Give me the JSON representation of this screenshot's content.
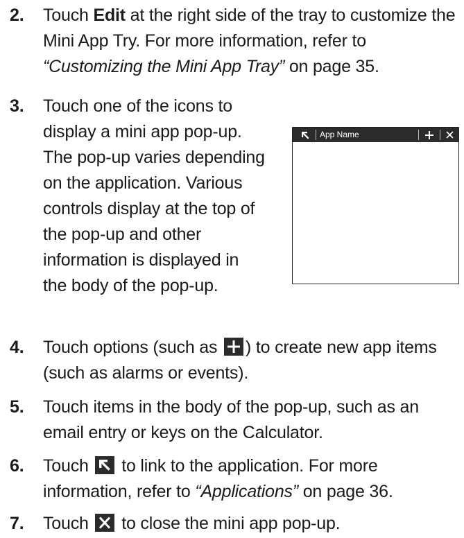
{
  "steps": [
    {
      "number": "2.",
      "lines": [
        [
          "Touch ",
          {
            "b": "Edit"
          },
          " at the right side of the tray to customize the"
        ],
        [
          "Mini App Try. For more information, refer to"
        ],
        [
          {
            "i": "“Customizing the Mini App Tray”"
          },
          " on page 35."
        ]
      ]
    },
    {
      "number": "3.",
      "lines": [
        [
          "Touch one of the icons to"
        ],
        [
          "display a mini app pop-up."
        ],
        [
          "The pop-up varies depending"
        ],
        [
          "on the application. Various"
        ],
        [
          "controls display at the top of"
        ],
        [
          "the pop-up and other"
        ],
        [
          "information is displayed in"
        ],
        [
          "the body of the pop-up."
        ]
      ]
    },
    {
      "number": "4.",
      "lines": [
        [
          "Touch options (such as ",
          {
            "icon": "plus-icon"
          },
          ") to create new app items"
        ],
        [
          "(such as alarms or events)."
        ]
      ]
    },
    {
      "number": "5.",
      "lines": [
        [
          "Touch items in the body of the pop-up, such as an"
        ],
        [
          "email entry or keys on the Calculator."
        ]
      ]
    },
    {
      "number": "6.",
      "lines": [
        [
          "Touch ",
          {
            "icon": "link-arrow-icon"
          },
          " to link to the application. For more"
        ],
        [
          "information, refer to ",
          {
            "i": "“Applications”"
          },
          " on page 36."
        ]
      ]
    },
    {
      "number": "7.",
      "lines": [
        [
          "Touch ",
          {
            "icon": "close-icon"
          },
          " to close the mini app pop-up."
        ]
      ]
    }
  ],
  "popup": {
    "title": "App Name",
    "plus_glyph": "+",
    "close_glyph": "×",
    "bar_color": "#2b2b2b",
    "icons": [
      "link-arrow-icon",
      "plus-icon",
      "close-icon"
    ]
  },
  "colors": {
    "text": "#1a1a1a",
    "icon_fill": "#2b2b2b"
  }
}
